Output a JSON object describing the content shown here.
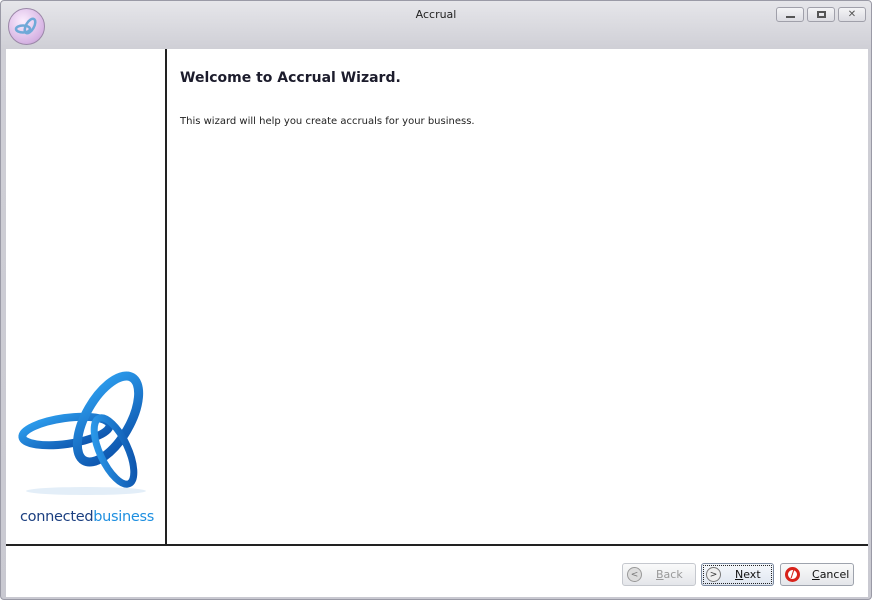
{
  "window": {
    "title": "Accrual",
    "controls": [
      "minimize",
      "maximize",
      "close"
    ]
  },
  "wizard": {
    "heading": "Welcome to Accrual Wizard.",
    "description": "This wizard will help you create accruals for your business."
  },
  "logo": {
    "text_part1": "connected",
    "text_part2": "business"
  },
  "buttons": {
    "back": {
      "mnemonic": "B",
      "rest": "ack"
    },
    "next": {
      "mnemonic": "N",
      "rest": "ext"
    },
    "cancel": {
      "mnemonic": "C",
      "rest": "ancel"
    }
  }
}
